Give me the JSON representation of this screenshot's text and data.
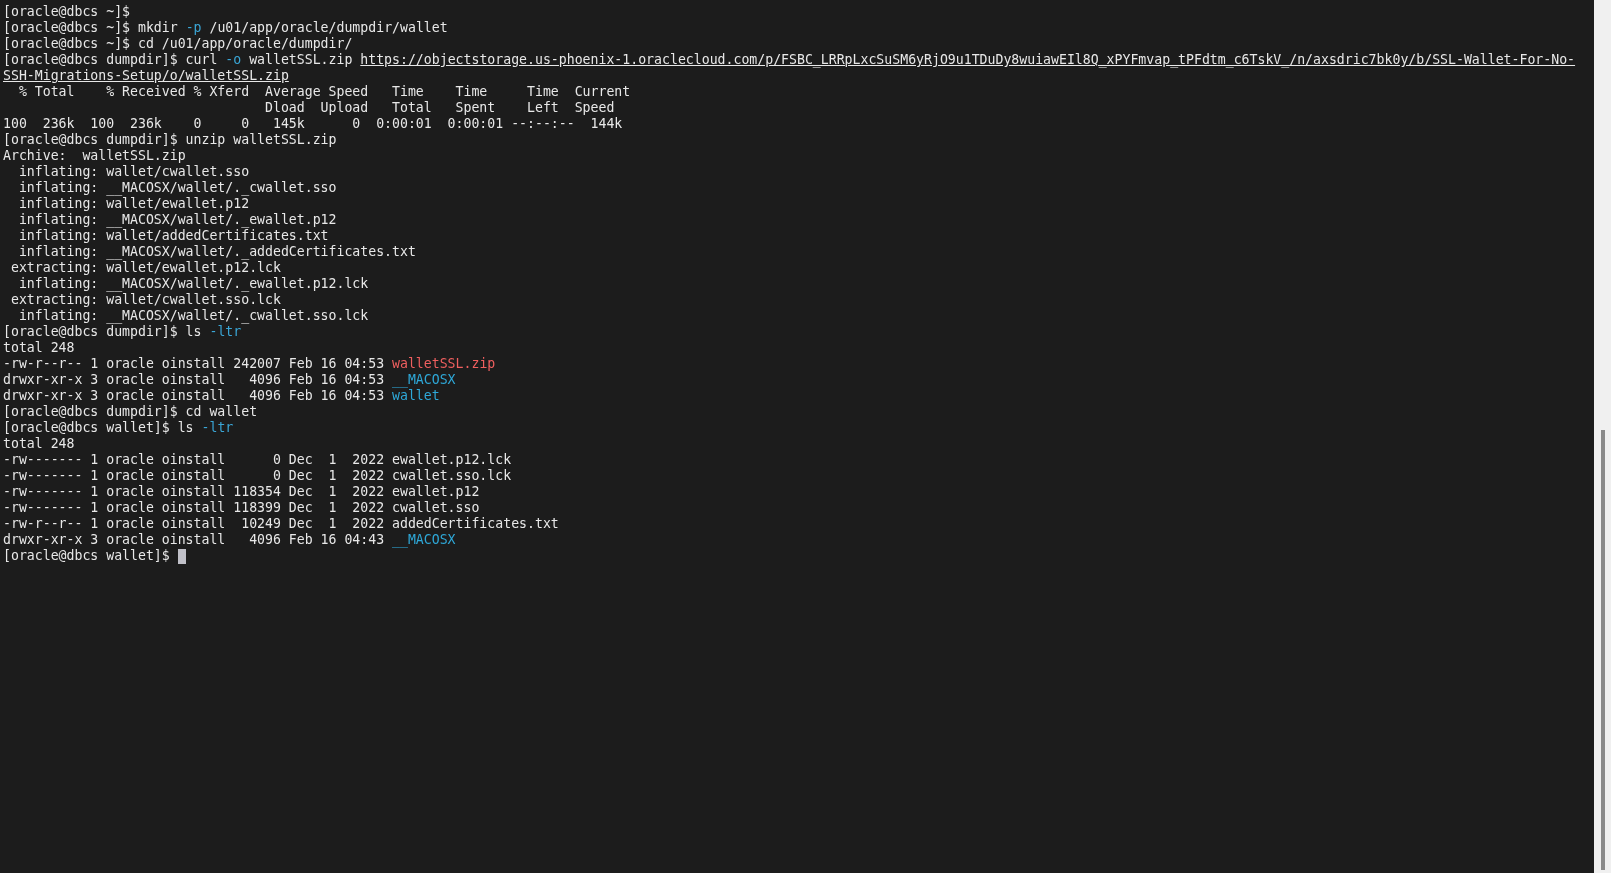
{
  "terminal": {
    "lines": [
      {
        "segments": [
          {
            "kind": "plain",
            "text": "[oracle@dbcs ~]$"
          }
        ]
      },
      {
        "segments": [
          {
            "kind": "plain",
            "text": "[oracle@dbcs ~]$ mkdir "
          },
          {
            "kind": "flag",
            "text": "-p"
          },
          {
            "kind": "plain",
            "text": " /u01/app/oracle/dumpdir/wallet"
          }
        ]
      },
      {
        "segments": [
          {
            "kind": "plain",
            "text": "[oracle@dbcs ~]$ cd /u01/app/oracle/dumpdir/"
          }
        ]
      },
      {
        "segments": [
          {
            "kind": "plain",
            "text": "[oracle@dbcs dumpdir]$ curl "
          },
          {
            "kind": "flag",
            "text": "-o"
          },
          {
            "kind": "plain",
            "text": " walletSSL.zip "
          },
          {
            "kind": "link",
            "text": "https://objectstorage.us-phoenix-1.oraclecloud.com/p/FSBC_LRRpLxcSuSM6yRjO9u1TDuDy8wuiawEIl8Q_xPYFmvap_tPFdtm_c6TskV_/n/axsdric7bk0y/b/SSL-Wallet-For-No-"
          }
        ]
      },
      {
        "segments": [
          {
            "kind": "link",
            "text": "SSH-Migrations-Setup/o/walletSSL.zip"
          }
        ]
      },
      {
        "segments": [
          {
            "kind": "plain",
            "text": "  % Total    % Received % Xferd  Average Speed   Time    Time     Time  Current"
          }
        ]
      },
      {
        "segments": [
          {
            "kind": "plain",
            "text": "                                 Dload  Upload   Total   Spent    Left  Speed"
          }
        ]
      },
      {
        "segments": [
          {
            "kind": "plain",
            "text": "100  236k  100  236k    0     0   145k      0  0:00:01  0:00:01 --:--:--  144k"
          }
        ]
      },
      {
        "segments": [
          {
            "kind": "plain",
            "text": "[oracle@dbcs dumpdir]$ unzip walletSSL.zip"
          }
        ]
      },
      {
        "segments": [
          {
            "kind": "plain",
            "text": "Archive:  walletSSL.zip"
          }
        ]
      },
      {
        "segments": [
          {
            "kind": "plain",
            "text": "  inflating: wallet/cwallet.sso"
          }
        ]
      },
      {
        "segments": [
          {
            "kind": "plain",
            "text": "  inflating: __MACOSX/wallet/._cwallet.sso"
          }
        ]
      },
      {
        "segments": [
          {
            "kind": "plain",
            "text": "  inflating: wallet/ewallet.p12"
          }
        ]
      },
      {
        "segments": [
          {
            "kind": "plain",
            "text": "  inflating: __MACOSX/wallet/._ewallet.p12"
          }
        ]
      },
      {
        "segments": [
          {
            "kind": "plain",
            "text": "  inflating: wallet/addedCertificates.txt"
          }
        ]
      },
      {
        "segments": [
          {
            "kind": "plain",
            "text": "  inflating: __MACOSX/wallet/._addedCertificates.txt"
          }
        ]
      },
      {
        "segments": [
          {
            "kind": "plain",
            "text": " extracting: wallet/ewallet.p12.lck"
          }
        ]
      },
      {
        "segments": [
          {
            "kind": "plain",
            "text": "  inflating: __MACOSX/wallet/._ewallet.p12.lck"
          }
        ]
      },
      {
        "segments": [
          {
            "kind": "plain",
            "text": " extracting: wallet/cwallet.sso.lck"
          }
        ]
      },
      {
        "segments": [
          {
            "kind": "plain",
            "text": "  inflating: __MACOSX/wallet/._cwallet.sso.lck"
          }
        ]
      },
      {
        "segments": [
          {
            "kind": "plain",
            "text": "[oracle@dbcs dumpdir]$ ls "
          },
          {
            "kind": "flag",
            "text": "-ltr"
          }
        ]
      },
      {
        "segments": [
          {
            "kind": "plain",
            "text": "total 248"
          }
        ]
      },
      {
        "segments": [
          {
            "kind": "plain",
            "text": "-rw-r--r-- 1 oracle oinstall 242007 Feb 16 04:53 "
          },
          {
            "kind": "archive",
            "text": "walletSSL.zip"
          }
        ]
      },
      {
        "segments": [
          {
            "kind": "plain",
            "text": "drwxr-xr-x 3 oracle oinstall   4096 Feb 16 04:53 "
          },
          {
            "kind": "dir",
            "text": "__MACOSX"
          }
        ]
      },
      {
        "segments": [
          {
            "kind": "plain",
            "text": "drwxr-xr-x 3 oracle oinstall   4096 Feb 16 04:53 "
          },
          {
            "kind": "dir",
            "text": "wallet"
          }
        ]
      },
      {
        "segments": [
          {
            "kind": "plain",
            "text": "[oracle@dbcs dumpdir]$ cd wallet"
          }
        ]
      },
      {
        "segments": [
          {
            "kind": "plain",
            "text": "[oracle@dbcs wallet]$ ls "
          },
          {
            "kind": "flag",
            "text": "-ltr"
          }
        ]
      },
      {
        "segments": [
          {
            "kind": "plain",
            "text": "total 248"
          }
        ]
      },
      {
        "segments": [
          {
            "kind": "plain",
            "text": "-rw------- 1 oracle oinstall      0 Dec  1  2022 ewallet.p12.lck"
          }
        ]
      },
      {
        "segments": [
          {
            "kind": "plain",
            "text": "-rw------- 1 oracle oinstall      0 Dec  1  2022 cwallet.sso.lck"
          }
        ]
      },
      {
        "segments": [
          {
            "kind": "plain",
            "text": "-rw------- 1 oracle oinstall 118354 Dec  1  2022 ewallet.p12"
          }
        ]
      },
      {
        "segments": [
          {
            "kind": "plain",
            "text": "-rw------- 1 oracle oinstall 118399 Dec  1  2022 cwallet.sso"
          }
        ]
      },
      {
        "segments": [
          {
            "kind": "plain",
            "text": "-rw-r--r-- 1 oracle oinstall  10249 Dec  1  2022 addedCertificates.txt"
          }
        ]
      },
      {
        "segments": [
          {
            "kind": "plain",
            "text": "drwxr-xr-x 3 oracle oinstall   4096 Feb 16 04:43 "
          },
          {
            "kind": "dir",
            "text": "__MACOSX"
          }
        ]
      },
      {
        "segments": [
          {
            "kind": "plain",
            "text": "[oracle@dbcs wallet]$ "
          }
        ],
        "cursor": true
      }
    ]
  }
}
